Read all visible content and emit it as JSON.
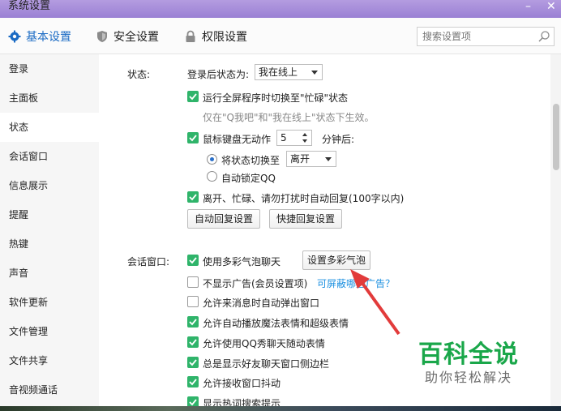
{
  "window": {
    "title": "系统设置",
    "minimize": "–",
    "close": "✕"
  },
  "tabs": [
    {
      "label": "基本设置",
      "icon": "gear-icon"
    },
    {
      "label": "安全设置",
      "icon": "shield-icon"
    },
    {
      "label": "权限设置",
      "icon": "lock-icon"
    }
  ],
  "search": {
    "placeholder": "搜索设置项",
    "icon": "search-icon"
  },
  "sidebar": {
    "items": [
      "登录",
      "主面板",
      "状态",
      "会话窗口",
      "信息展示",
      "提醒",
      "热键",
      "声音",
      "软件更新",
      "文件管理",
      "文件共享",
      "音视频通话"
    ],
    "active": "状态"
  },
  "status": {
    "section_label": "状态:",
    "login_status_label": "登录后状态为:",
    "login_status_value": "我在线上",
    "fullscreen_busy": "运行全屏程序时切换至\"忙碌\"状态",
    "fullscreen_note": "仅在\"Q我吧\"和\"我在线上\"状态下生效。",
    "idle_label": "鼠标键盘无动作",
    "idle_minutes": "5",
    "idle_suffix": "分钟后:",
    "switch_to_label": "将状态切换至",
    "switch_to_value": "离开",
    "auto_lock": "自动锁定QQ",
    "auto_reply": "离开、忙碌、请勿打扰时自动回复(100字以内)",
    "auto_reply_btn": "自动回复设置",
    "quick_reply_btn": "快捷回复设置"
  },
  "chat": {
    "section_label": "会话窗口:",
    "bubble": "使用多彩气泡聊天",
    "bubble_btn": "设置多彩气泡",
    "no_ads": "不显示广告(会员设置项)",
    "block_ads_link": "可屏蔽哪些广告？",
    "popup": "允许来消息时自动弹出窗口",
    "magic": "允许自动播放魔法表情和超级表情",
    "qqshow": "允许使用QQ秀聊天随动表情",
    "sidebar_always": "总是显示好友聊天窗口侧边栏",
    "shake": "允许接收窗口抖动",
    "hot_search": "显示热词搜索提示"
  },
  "watermark": {
    "brand": "百科全说",
    "slogan": "助你轻松解决"
  },
  "colors": {
    "accent": "#1b6bc4",
    "check_green": "#2fb46a",
    "arrow_red": "#e23b3b",
    "brand_green": "#1aa74a"
  }
}
